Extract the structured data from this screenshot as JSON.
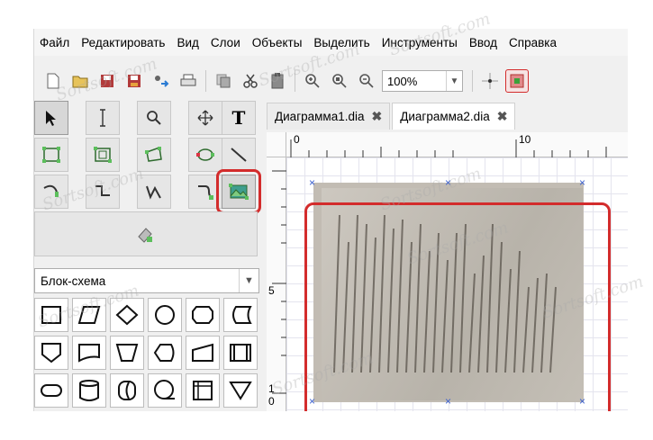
{
  "menu": [
    "Файл",
    "Редактировать",
    "Вид",
    "Слои",
    "Объекты",
    "Выделить",
    "Инструменты",
    "Ввод",
    "Справка"
  ],
  "toolbar": {
    "zoom_value": "100%"
  },
  "toolbox": {
    "text_tool_glyph": "T",
    "sheet_name": "Блок-схема"
  },
  "tabs": [
    {
      "label": "Диаграмма1.dia",
      "active": false
    },
    {
      "label": "Диаграмма2.dia",
      "active": true
    }
  ],
  "rulers": {
    "top": [
      "0",
      "10"
    ],
    "left": [
      "5",
      "1",
      "0"
    ]
  },
  "watermark": "Sortsoft.com",
  "colors": {
    "highlight": "#d32c2c",
    "handle": "#3a5fcf"
  }
}
